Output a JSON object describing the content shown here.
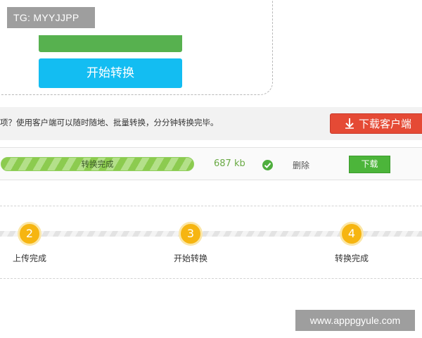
{
  "watermarks": {
    "top": "TG: MYYJJPP",
    "bottom": "www.apppgyule.com"
  },
  "converter": {
    "start_label": "开始转换"
  },
  "promo": {
    "text": "项？使用客户端可以随时随地、批量转换，分分钟转换完毕。",
    "download_client_label": "下载客户端",
    "download_client_icon": "download-arrow-icon",
    "accent_color": "#e54a35"
  },
  "file": {
    "status": "转换完成",
    "progress_percent": 100,
    "size": "687 kb",
    "delete_label": "删除",
    "download_label": "下载"
  },
  "steps": [
    {
      "number": "2",
      "label": "上传完成"
    },
    {
      "number": "3",
      "label": "开始转换"
    },
    {
      "number": "4",
      "label": "转换完成"
    }
  ]
}
